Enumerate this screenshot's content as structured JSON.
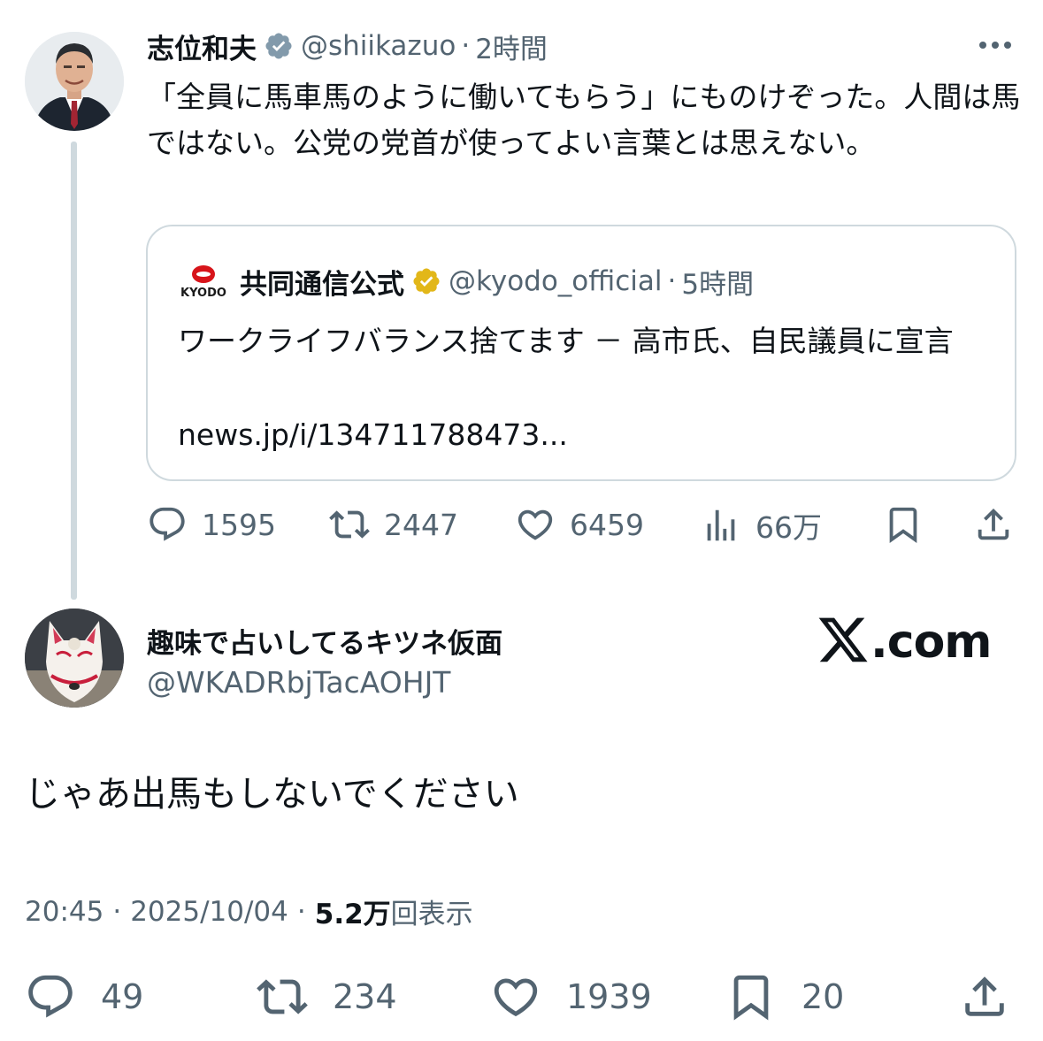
{
  "parent": {
    "name": "志位和夫",
    "handle": "@shiikazuo",
    "dot": "·",
    "time": "2時間",
    "text": "「全員に馬車馬のように働いてもらう」にものけぞった。人間は馬ではない。公党の党首が使ってよい言葉とは思えない。",
    "quote": {
      "logo_text": "KYODO",
      "name": "共同通信公式",
      "handle": "@kyodo_official",
      "dot": "·",
      "time": "5時間",
      "text": "ワークライフバランス捨てます － 高市氏、自民議員に宣言",
      "link": "news.jp/i/134711788473..."
    },
    "actions": {
      "replies": "1595",
      "reposts": "2447",
      "likes": "6459",
      "views": "66万"
    }
  },
  "reply": {
    "name": "趣味で占いしてるキツネ仮面",
    "handle": "@WKADRbjTacAOHJT",
    "watermark": ".com",
    "text": "じゃあ出馬もしないでください",
    "time": "20:45",
    "dot1": "·",
    "date": "2025/10/04",
    "dot2": "·",
    "views_count": "5.2万",
    "views_label": "回表示",
    "actions": {
      "replies": "49",
      "reposts": "234",
      "likes": "1939",
      "bookmarks": "20"
    }
  },
  "colors": {
    "text": "#0f1419",
    "secondary": "#536471",
    "border": "#cfd9de",
    "verified_gray": "#829aab",
    "verified_gold": "#e2b719",
    "kyodo_red": "#d7141a"
  },
  "icons": [
    "more-icon",
    "verified-gray-icon",
    "verified-gold-icon",
    "reply-icon",
    "repost-icon",
    "like-icon",
    "views-icon",
    "bookmark-icon",
    "share-icon",
    "x-logo-icon"
  ]
}
